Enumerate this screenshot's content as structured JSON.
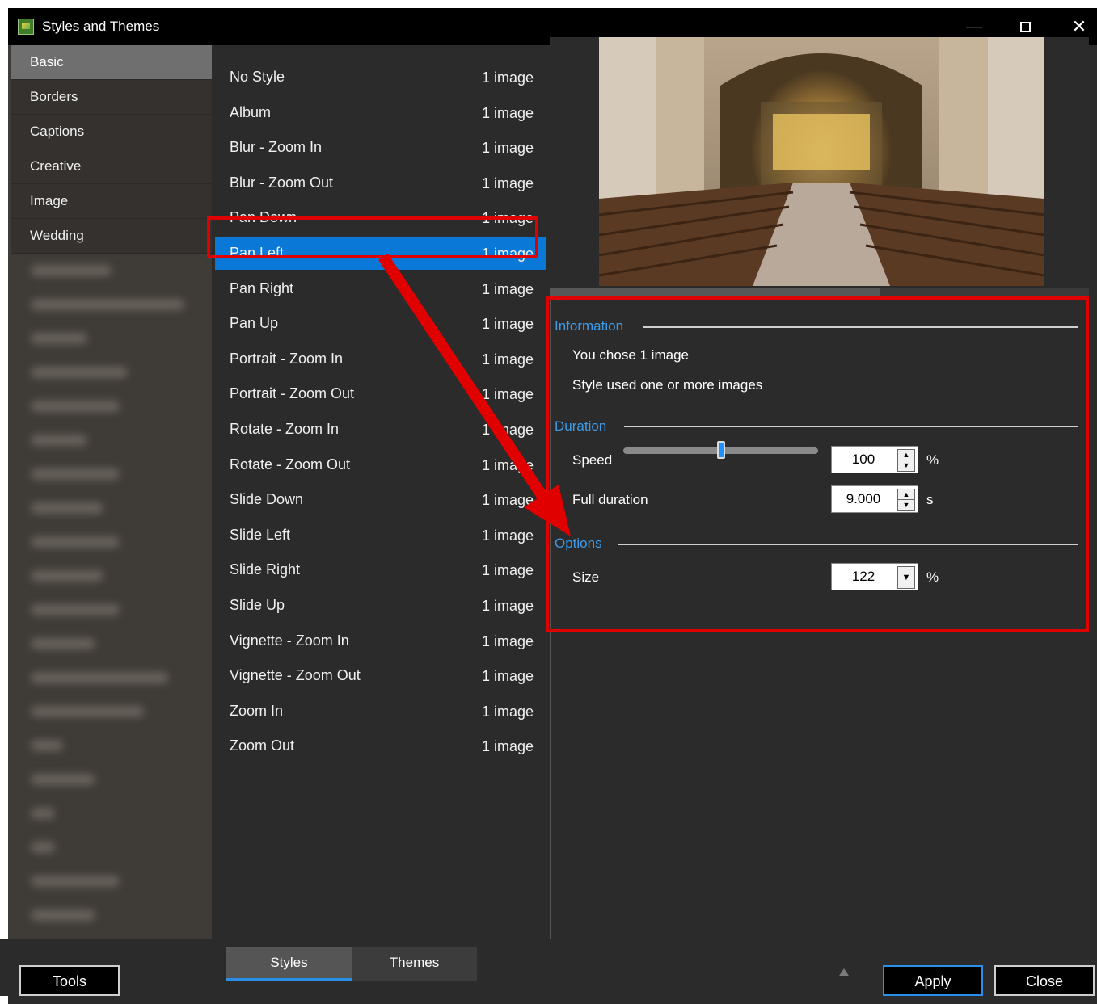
{
  "window": {
    "title": "Styles and Themes"
  },
  "categories": {
    "selected": "Basic",
    "items": [
      "Basic",
      "Borders",
      "Captions",
      "Creative",
      "Image",
      "Wedding"
    ]
  },
  "styles": [
    {
      "name": "No Style",
      "count": "1 image"
    },
    {
      "name": "Album",
      "count": "1 image"
    },
    {
      "name": "Blur - Zoom In",
      "count": "1 image"
    },
    {
      "name": "Blur - Zoom Out",
      "count": "1 image"
    },
    {
      "name": "Pan Down",
      "count": "1 image"
    },
    {
      "name": "Pan Left",
      "count": "1 image"
    },
    {
      "name": "Pan Right",
      "count": "1 image"
    },
    {
      "name": "Pan Up",
      "count": "1 image"
    },
    {
      "name": "Portrait - Zoom In",
      "count": "1 image"
    },
    {
      "name": "Portrait - Zoom Out",
      "count": "1 image"
    },
    {
      "name": "Rotate - Zoom In",
      "count": "1 image"
    },
    {
      "name": "Rotate - Zoom Out",
      "count": "1 image"
    },
    {
      "name": "Slide Down",
      "count": "1 image"
    },
    {
      "name": "Slide Left",
      "count": "1 image"
    },
    {
      "name": "Slide Right",
      "count": "1 image"
    },
    {
      "name": "Slide Up",
      "count": "1 image"
    },
    {
      "name": "Vignette - Zoom In",
      "count": "1 image"
    },
    {
      "name": "Vignette - Zoom Out",
      "count": "1 image"
    },
    {
      "name": "Zoom In",
      "count": "1 image"
    },
    {
      "name": "Zoom Out",
      "count": "1 image"
    }
  ],
  "selected_style": "Pan Left",
  "info": {
    "information_label": "Information",
    "chose_text": "You chose 1 image",
    "used_text": "Style used one or more images",
    "duration_label": "Duration",
    "speed_label": "Speed",
    "speed_value": "100",
    "speed_unit": "%",
    "speed_slider_fraction": 0.5,
    "full_duration_label": "Full duration",
    "full_duration_value": "9.000",
    "full_duration_unit": "s",
    "options_label": "Options",
    "size_label": "Size",
    "size_value": "122",
    "size_unit": "%"
  },
  "bottom": {
    "tools_label": "Tools",
    "tab_styles": "Styles",
    "tab_themes": "Themes",
    "apply_label": "Apply",
    "close_label": "Close"
  },
  "colors": {
    "accent": "#0a78d7",
    "section_label": "#3d9be9",
    "annotation_red": "#e00000"
  }
}
